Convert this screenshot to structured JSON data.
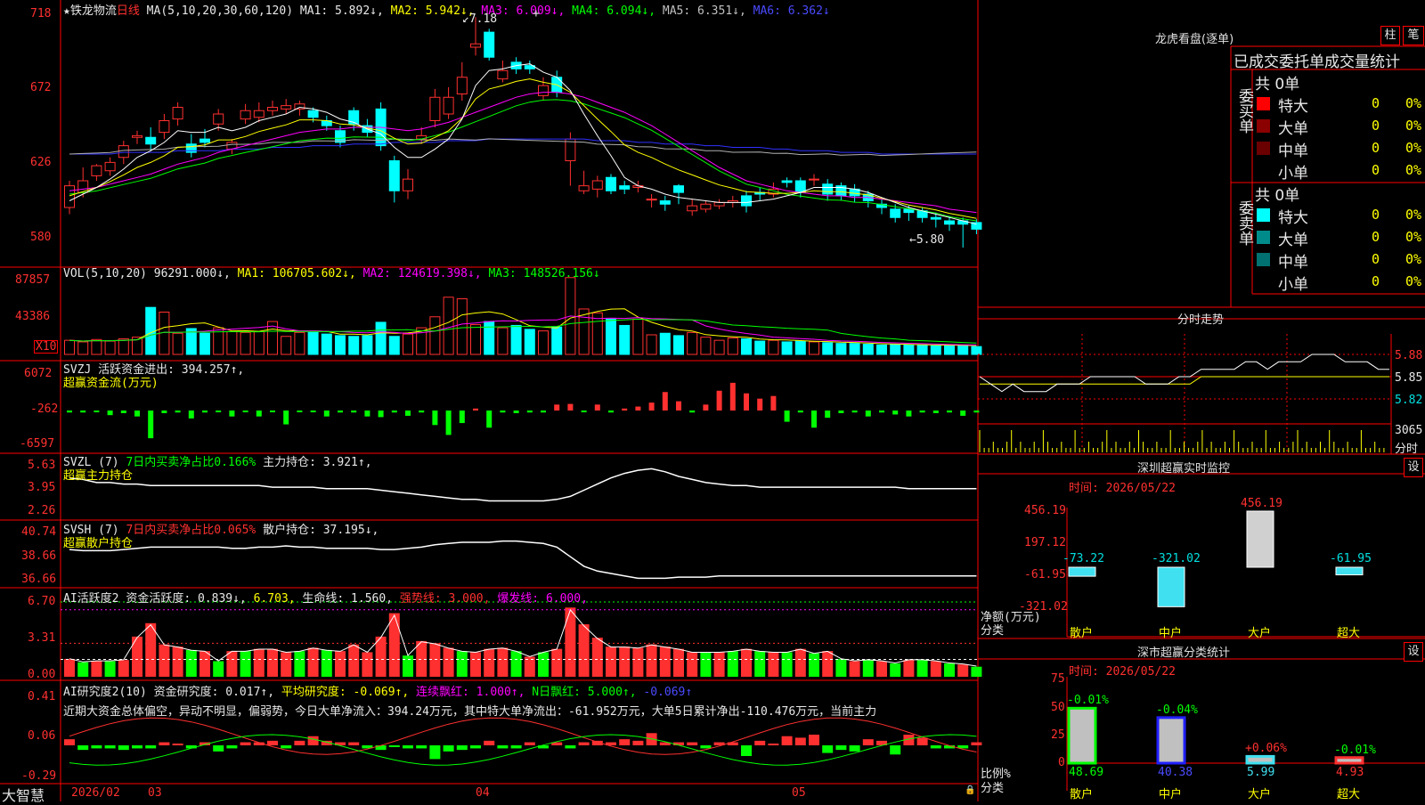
{
  "app": {
    "brand": "大智慧",
    "stock_name": "★铁龙物流",
    "period": "日线"
  },
  "colors": {
    "up": "#ff3030",
    "down": "#00ffff",
    "grid": "#ff0000",
    "text": "#e0e0e0",
    "ma1": "#ffffff",
    "ma2": "#ffff00",
    "ma3": "#ff00ff",
    "ma4": "#00ff00",
    "ma5": "#b0b0b0",
    "ma6": "#3030ff"
  },
  "main_header": {
    "ma_label": "MA(5,10,20,30,60,120)",
    "ma1": "MA1: 5.892↓,",
    "ma2": "MA2: 5.942↓,",
    "ma3": "MA3: 6.009↓,",
    "ma4": "MA4: 6.094↓,",
    "ma5": "MA5: 6.351↓,",
    "ma6": "MA6: 6.362↓"
  },
  "vol_header": {
    "label": "VOL(5,10,20)",
    "value": "96291.000↓,",
    "ma1": "MA1: 106705.602↓,",
    "ma2": "MA2: 124619.398↓,",
    "ma3": "MA3: 148526.156↓"
  },
  "svzj_header": {
    "label": "SVZJ",
    "text": "活跃资金进出: 394.257↑,",
    "sub": "超赢资金流(万元)"
  },
  "svzl_header": {
    "label": "SVZL (7)",
    "text1": "7日内买卖净占比0.166%",
    "text2": "主力持仓: 3.921↑,",
    "sub": "超赢主力持仓"
  },
  "svsh_header": {
    "label": "SVSH (7)",
    "text1": "7日内买卖净占比0.065%",
    "text2": "散户持仓: 37.195↓,",
    "sub": "超赢散户持仓"
  },
  "ai1_header": {
    "label": "AI活跃度2",
    "t1": "资金活跃度: 0.839↓,",
    "t2": "6.703,",
    "t3": "生命线: 1.560,",
    "t4": "强势线: 3.000,",
    "t5": "爆发线: 6.000,"
  },
  "ai2_header": {
    "label": "AI研究度2(10)",
    "t1": "资金研究度: 0.017↑,",
    "t2": "平均研究度: -0.069↑,",
    "t3": "连续飘红: 1.000↑,",
    "t4": "N日飘红: 5.000↑,",
    "t5": "-0.069↑",
    "comment": "近期大资金总体偏空，异动不明显，偏弱势，今日大单净流入：394.24万元，其中特大单净流出：-61.952万元，大单5日累计净出-110.476万元，当前主力"
  },
  "axes": {
    "price_ticks": [
      "718",
      "672",
      "626",
      "580"
    ],
    "vol_ticks": [
      "87857",
      "43386"
    ],
    "vol_unit": "X10",
    "svzj_ticks": [
      "6072",
      "-262",
      "-6597"
    ],
    "svzl_ticks": [
      "5.63",
      "3.95",
      "2.26"
    ],
    "svsh_ticks": [
      "40.74",
      "38.66",
      "36.66"
    ],
    "ai1_ticks": [
      "6.70",
      "3.31",
      "0.00"
    ],
    "ai2_ticks": [
      "0.41",
      "0.06",
      "-0.29"
    ],
    "date_labels": [
      "2026/02",
      "03",
      "04",
      "05"
    ]
  },
  "price_annotations": {
    "high": "7.18",
    "low": "5.80",
    "cursor": "+"
  },
  "chart_data": [
    {
      "type": "candlestick",
      "title": "铁龙物流 日线",
      "ylim": [
        5.72,
        7.24
      ],
      "open": [
        6.04,
        6.13,
        6.23,
        6.26,
        6.34,
        6.46,
        6.46,
        6.49,
        6.57,
        6.42,
        6.45,
        6.54,
        6.39,
        6.57,
        6.58,
        6.62,
        6.63,
        6.63,
        6.62,
        6.56,
        6.5,
        6.62,
        6.53,
        6.63,
        6.32,
        6.14,
        6.45,
        6.56,
        6.6,
        6.72,
        7.0,
        7.09,
        6.81,
        6.91,
        6.89,
        6.71,
        6.82,
        6.32,
        6.14,
        6.15,
        6.22,
        6.17,
        6.16,
        6.09,
        6.08,
        6.17,
        6.02,
        6.03,
        6.05,
        6.07,
        6.11,
        6.13,
        6.12,
        6.2,
        6.2,
        6.21,
        6.18,
        6.17,
        6.15,
        6.12,
        6.06,
        6.03,
        6.03,
        6.02,
        5.98,
        5.96,
        5.96,
        5.95
      ],
      "close": [
        6.17,
        6.2,
        6.29,
        6.31,
        6.41,
        6.47,
        6.42,
        6.56,
        6.64,
        6.37,
        6.43,
        6.6,
        6.43,
        6.62,
        6.62,
        6.64,
        6.65,
        6.66,
        6.58,
        6.53,
        6.43,
        6.54,
        6.49,
        6.41,
        6.14,
        6.21,
        6.47,
        6.7,
        6.7,
        6.82,
        7.02,
        6.94,
        6.86,
        6.87,
        6.87,
        6.77,
        6.73,
        6.45,
        6.17,
        6.2,
        6.14,
        6.15,
        6.17,
        6.09,
        6.06,
        6.13,
        6.05,
        6.06,
        6.07,
        6.08,
        6.05,
        6.12,
        6.15,
        6.19,
        6.13,
        6.21,
        6.12,
        6.11,
        6.11,
        6.08,
        6.04,
        5.98,
        6.01,
        5.98,
        5.97,
        5.94,
        5.94,
        5.91
      ],
      "high": [
        6.2,
        6.28,
        6.3,
        6.34,
        6.44,
        6.5,
        6.52,
        6.6,
        6.67,
        6.48,
        6.51,
        6.63,
        6.45,
        6.66,
        6.67,
        6.68,
        6.69,
        6.68,
        6.64,
        6.59,
        6.53,
        6.64,
        6.57,
        6.67,
        6.35,
        6.27,
        6.52,
        6.75,
        6.76,
        6.91,
        7.18,
        7.11,
        6.92,
        6.94,
        6.92,
        6.82,
        6.86,
        6.49,
        6.26,
        6.23,
        6.24,
        6.2,
        6.2,
        6.12,
        6.11,
        6.18,
        6.09,
        6.08,
        6.09,
        6.11,
        6.14,
        6.16,
        6.19,
        6.22,
        6.22,
        6.24,
        6.21,
        6.19,
        6.18,
        6.14,
        6.09,
        6.06,
        6.05,
        6.04,
        6.01,
        5.99,
        5.98,
        5.97
      ],
      "low": [
        6.0,
        6.1,
        6.2,
        6.23,
        6.3,
        6.42,
        6.38,
        6.45,
        6.53,
        6.34,
        6.4,
        6.5,
        6.36,
        6.54,
        6.55,
        6.59,
        6.6,
        6.59,
        6.55,
        6.5,
        6.4,
        6.5,
        6.46,
        6.38,
        6.07,
        6.09,
        6.42,
        6.52,
        6.57,
        6.68,
        6.95,
        6.92,
        6.79,
        6.84,
        6.84,
        6.68,
        6.7,
        6.17,
        6.12,
        6.1,
        6.12,
        6.12,
        6.13,
        6.04,
        6.02,
        6.06,
        5.99,
        6.01,
        6.03,
        6.04,
        6.01,
        6.08,
        6.1,
        6.16,
        6.1,
        6.17,
        6.08,
        6.08,
        6.07,
        6.04,
        6.0,
        5.95,
        5.96,
        5.95,
        5.92,
        5.9,
        5.8,
        5.88
      ],
      "ma5": [
        6.08,
        6.12,
        6.16,
        6.21,
        6.27,
        6.34,
        6.38,
        6.43,
        6.5,
        6.49,
        6.49,
        6.52,
        6.5,
        6.52,
        6.56,
        6.58,
        6.6,
        6.64,
        6.63,
        6.61,
        6.57,
        6.55,
        6.51,
        6.48,
        6.4,
        6.34,
        6.34,
        6.39,
        6.45,
        6.57,
        6.77,
        6.86,
        6.87,
        6.89,
        6.9,
        6.85,
        6.82,
        6.74,
        6.6,
        6.47,
        6.35,
        6.22,
        6.17,
        6.15,
        6.12,
        6.1,
        6.09,
        6.08,
        6.07,
        6.07,
        6.07,
        6.08,
        6.09,
        6.11,
        6.13,
        6.16,
        6.16,
        6.16,
        6.15,
        6.13,
        6.1,
        6.07,
        6.04,
        6.02,
        6.0,
        5.98,
        5.96,
        5.94
      ],
      "ma20": [
        6.14,
        6.15,
        6.16,
        6.18,
        6.2,
        6.22,
        6.24,
        6.27,
        6.3,
        6.32,
        6.34,
        6.37,
        6.39,
        6.41,
        6.43,
        6.45,
        6.47,
        6.49,
        6.5,
        6.51,
        6.51,
        6.52,
        6.52,
        6.52,
        6.51,
        6.5,
        6.51,
        6.53,
        6.55,
        6.58,
        6.61,
        6.64,
        6.67,
        6.7,
        6.72,
        6.73,
        6.73,
        6.72,
        6.7,
        6.67,
        6.64,
        6.61,
        6.57,
        6.53,
        6.48,
        6.43,
        6.38,
        6.33,
        6.28,
        6.24,
        6.2,
        6.18,
        6.16,
        6.14,
        6.13,
        6.12,
        6.11,
        6.11,
        6.1,
        6.1,
        6.09,
        6.08,
        6.07,
        6.06,
        6.05,
        6.03,
        6.02,
        6.01
      ],
      "ma120": [
        6.36,
        6.36,
        6.36,
        6.36,
        6.37,
        6.37,
        6.37,
        6.37,
        6.38,
        6.38,
        6.38,
        6.38,
        6.39,
        6.39,
        6.39,
        6.4,
        6.4,
        6.4,
        6.41,
        6.41,
        6.41,
        6.42,
        6.42,
        6.42,
        6.43,
        6.43,
        6.43,
        6.43,
        6.44,
        6.44,
        6.44,
        6.45,
        6.45,
        6.45,
        6.45,
        6.45,
        6.45,
        6.45,
        6.45,
        6.44,
        6.44,
        6.44,
        6.43,
        6.43,
        6.42,
        6.42,
        6.42,
        6.41,
        6.41,
        6.4,
        6.4,
        6.4,
        6.39,
        6.39,
        6.38,
        6.38,
        6.38,
        6.37,
        6.37,
        6.37,
        6.36,
        6.36,
        6.36,
        6.36,
        6.36,
        6.36,
        6.36,
        6.36
      ]
    },
    {
      "type": "bar",
      "title": "VOL",
      "ylim": [
        0,
        100000
      ],
      "values": [
        18000,
        16000,
        19000,
        17000,
        20000,
        22000,
        60000,
        54000,
        27000,
        33000,
        27000,
        34000,
        29000,
        28000,
        29000,
        42000,
        23000,
        28000,
        28000,
        26000,
        24000,
        23000,
        24000,
        41000,
        23000,
        26000,
        34000,
        48000,
        73000,
        71000,
        38000,
        42000,
        34000,
        37000,
        32000,
        30000,
        35000,
        98000,
        58000,
        53000,
        45000,
        37000,
        45000,
        25000,
        27000,
        24000,
        28000,
        22000,
        18000,
        21000,
        20000,
        17000,
        18000,
        16000,
        17000,
        16000,
        15000,
        14000,
        14000,
        13000,
        12000,
        13000,
        12000,
        12000,
        11000,
        11000,
        12000,
        10000
      ]
    },
    {
      "type": "bar",
      "title": "超赢资金流(万元)",
      "ylim": [
        -6597,
        6072
      ],
      "values": [
        -300,
        -300,
        0,
        -700,
        -400,
        -900,
        -4200,
        -400,
        -300,
        -1200,
        -300,
        0,
        -900,
        -200,
        -900,
        0,
        -2100,
        0,
        0,
        -900,
        -300,
        -300,
        -900,
        -1000,
        -300,
        -800,
        -300,
        -2200,
        -3700,
        -1900,
        300,
        -2600,
        -300,
        -400,
        -300,
        -300,
        900,
        1000,
        0,
        900,
        -300,
        300,
        600,
        1200,
        2800,
        1400,
        -300,
        900,
        3000,
        4200,
        2600,
        1800,
        2200,
        -1700,
        -300,
        -2600,
        -1100,
        -400,
        -300,
        -900,
        -300,
        -600,
        -900,
        -300,
        -400,
        -300,
        -800,
        -300
      ]
    },
    {
      "type": "line",
      "title": "超赢主力持仓",
      "ylim": [
        2.26,
        5.63
      ],
      "values": [
        4.6,
        4.5,
        4.3,
        4.3,
        4.2,
        4.2,
        4.1,
        4.1,
        4.1,
        4.1,
        4.1,
        4.1,
        4.1,
        4.1,
        4.1,
        4.0,
        4.0,
        4.0,
        4.0,
        3.9,
        3.9,
        3.9,
        3.9,
        3.8,
        3.7,
        3.6,
        3.5,
        3.4,
        3.3,
        3.2,
        3.2,
        3.1,
        3.1,
        3.1,
        3.1,
        3.1,
        3.2,
        3.4,
        3.8,
        4.2,
        4.6,
        4.9,
        5.1,
        5.2,
        5.0,
        4.7,
        4.5,
        4.3,
        4.2,
        4.1,
        4.1,
        4.0,
        4.0,
        4.0,
        4.0,
        4.0,
        4.0,
        4.0,
        4.0,
        4.0,
        4.0,
        4.0,
        3.9,
        3.9,
        3.9,
        3.9,
        3.9,
        3.9
      ]
    },
    {
      "type": "line",
      "title": "超赢散户持仓",
      "ylim": [
        36.66,
        40.74
      ],
      "values": [
        39.4,
        39.3,
        39.3,
        39.3,
        39.4,
        39.5,
        39.6,
        39.6,
        39.6,
        39.6,
        39.6,
        39.6,
        39.5,
        39.5,
        39.6,
        39.6,
        39.7,
        39.6,
        39.6,
        39.5,
        39.5,
        39.5,
        39.5,
        39.4,
        39.4,
        39.5,
        39.6,
        39.8,
        39.9,
        40.0,
        40.0,
        40.0,
        40.1,
        40.1,
        40.0,
        39.9,
        39.6,
        38.8,
        38.0,
        37.6,
        37.4,
        37.2,
        37.0,
        37.0,
        37.0,
        37.1,
        37.1,
        37.1,
        37.2,
        37.2,
        37.2,
        37.2,
        37.2,
        37.2,
        37.2,
        37.2,
        37.2,
        37.2,
        37.2,
        37.2,
        37.2,
        37.2,
        37.2,
        37.2,
        37.2,
        37.2,
        37.2,
        37.2
      ]
    },
    {
      "type": "bar",
      "title": "AI活跃度2",
      "ylim": [
        0,
        6.7
      ],
      "values": [
        1.6,
        1.3,
        1.4,
        1.4,
        1.5,
        3.6,
        4.8,
        2.9,
        2.7,
        2.4,
        2.3,
        1.4,
        2.3,
        2.3,
        2.5,
        2.5,
        2.2,
        2.3,
        2.6,
        2.4,
        2.3,
        2.9,
        2.2,
        3.6,
        5.7,
        1.9,
        3.2,
        3.0,
        2.6,
        2.3,
        2.2,
        2.5,
        2.6,
        2.3,
        1.8,
        2.2,
        2.5,
        6.2,
        4.7,
        3.5,
        2.7,
        2.7,
        2.6,
        2.9,
        2.7,
        2.5,
        2.2,
        2.2,
        2.2,
        2.3,
        2.5,
        2.3,
        2.2,
        2.2,
        2.5,
        2.1,
        2.3,
        1.6,
        1.4,
        1.5,
        1.4,
        1.2,
        1.5,
        1.5,
        1.4,
        1.2,
        1.1,
        0.9
      ],
      "life_line": 1.56,
      "strong_line": 3.0,
      "burst_line": 6.0
    },
    {
      "type": "bar",
      "title": "AI研究度2(10)",
      "ylim": [
        -0.29,
        0.41
      ],
      "values": [
        0.04,
        -0.03,
        -0.02,
        -0.02,
        -0.03,
        -0.02,
        -0.02,
        0.02,
        0.01,
        -0.02,
        0.02,
        -0.04,
        -0.02,
        0.02,
        0.02,
        0.03,
        -0.02,
        0.03,
        0.06,
        0.03,
        0.02,
        0.02,
        -0.02,
        -0.03,
        -0.01,
        -0.02,
        -0.02,
        -0.09,
        -0.04,
        -0.03,
        -0.02,
        0.03,
        -0.02,
        -0.02,
        0.02,
        -0.02,
        0.02,
        -0.02,
        0.02,
        0.03,
        0.02,
        0.04,
        0.03,
        0.08,
        0.02,
        0.02,
        0.02,
        -0.02,
        0.02,
        0.02,
        -0.07,
        0.03,
        0.01,
        0.06,
        0.05,
        0.07,
        -0.05,
        -0.03,
        -0.04,
        0.04,
        0.03,
        -0.06,
        0.07,
        0.05,
        -0.02,
        -0.02,
        -0.02,
        0.02
      ]
    }
  ],
  "right": {
    "lhkp_title": "龙虎看盘(逐单)",
    "btn_zhu": "柱",
    "btn_bi": "笔",
    "tabs_label": "已成交委托单成交量统计",
    "buy_group": "委买单",
    "buy_total": "共 0单",
    "sell_group": "委卖单",
    "sell_total": "共 0单",
    "rows": [
      {
        "name": "特大",
        "count": "0",
        "pct": "0%",
        "buy_color": "#ff0000",
        "sell_color": "#00ffff"
      },
      {
        "name": "大单",
        "count": "0",
        "pct": "0%",
        "buy_color": "#8b0000",
        "sell_color": "#008b8b"
      },
      {
        "name": "中单",
        "count": "0",
        "pct": "0%",
        "buy_color": "#6b0000",
        "sell_color": "#007070"
      },
      {
        "name": "小单",
        "count": "0",
        "pct": "0%",
        "buy_color": "#000000",
        "sell_color": "#000000"
      }
    ],
    "fenshi_title": "分时走势",
    "fenshi_ticks": [
      "5.88",
      "5.85",
      "5.82"
    ],
    "fenshi_vol": "3065",
    "fenshi_unit": "分时",
    "fenshi_prices": [
      5.85,
      5.84,
      5.83,
      5.84,
      5.83,
      5.83,
      5.83,
      5.84,
      5.84,
      5.84,
      5.85,
      5.85,
      5.85,
      5.85,
      5.85,
      5.84,
      5.84,
      5.84,
      5.85,
      5.85,
      5.86,
      5.86,
      5.86,
      5.86,
      5.87,
      5.87,
      5.86,
      5.87,
      5.87,
      5.87,
      5.88,
      5.88,
      5.88,
      5.87,
      5.87,
      5.87,
      5.86,
      5.86
    ],
    "fenshi_avg": [
      5.84,
      5.84,
      5.84,
      5.84,
      5.84,
      5.84,
      5.84,
      5.84,
      5.84,
      5.84,
      5.84,
      5.84,
      5.84,
      5.84,
      5.84,
      5.84,
      5.84,
      5.84,
      5.84,
      5.84,
      5.85,
      5.85,
      5.85,
      5.85,
      5.85,
      5.85,
      5.85,
      5.85,
      5.85,
      5.85,
      5.85,
      5.85,
      5.85,
      5.85,
      5.85,
      5.85,
      5.85,
      5.85
    ],
    "monitor_title": "深圳超赢实时监控",
    "set": "设",
    "monitor_time": "时间: 2026/05/22",
    "monitor_ticks": [
      "456.19",
      "197.12",
      "-61.95",
      "-321.02"
    ],
    "monitor_ylabel": "净额(万元)",
    "monitor_xlabel": "分类",
    "monitor_bars": [
      {
        "label": "散户",
        "value": -73.22,
        "value_text": "-73.22"
      },
      {
        "label": "中户",
        "value": -321.02,
        "value_text": "-321.02"
      },
      {
        "label": "大户",
        "value": 456.19,
        "value_text": "456.19"
      },
      {
        "label": "超大",
        "value": -61.95,
        "value_text": "-61.95"
      }
    ],
    "stats_title": "深市超赢分类统计",
    "stats_time": "时间: 2026/05/22",
    "stats_ticks": [
      "75",
      "50",
      "25",
      "0"
    ],
    "stats_ylabel": "比例%",
    "stats_xlabel": "分类",
    "stats_bars": [
      {
        "label": "散户",
        "value": 48.69,
        "value_text": "48.69",
        "delta": "-0.01%"
      },
      {
        "label": "中户",
        "value": 40.38,
        "value_text": "40.38",
        "delta": "-0.04%"
      },
      {
        "label": "大户",
        "value": 5.99,
        "value_text": "5.99",
        "delta": "+0.06%"
      },
      {
        "label": "超大",
        "value": 4.93,
        "value_text": "4.93",
        "delta": "-0.01%"
      }
    ]
  }
}
